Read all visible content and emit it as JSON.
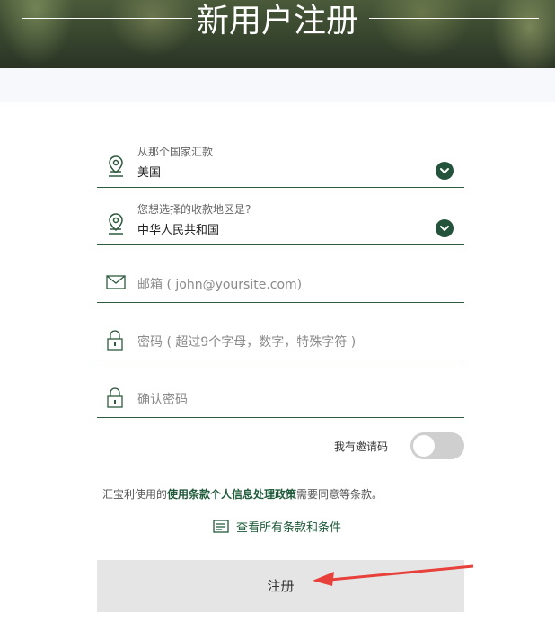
{
  "header": {
    "title": "新用户注册"
  },
  "form": {
    "remit_country": {
      "label": "从那个国家汇款",
      "value": "美国"
    },
    "receive_region": {
      "label": "您想选择的收款地区是?",
      "value": "中华人民共和国"
    },
    "email": {
      "placeholder": "邮箱 ( john@yoursite.com)"
    },
    "password": {
      "placeholder": "密码 ( 超过9个字母，数字，特殊字符 )"
    },
    "confirm_password": {
      "placeholder": "确认密码"
    },
    "invite_toggle": {
      "label": "我有邀请码",
      "on": false
    }
  },
  "terms": {
    "prefix": "汇宝利使用的",
    "link1": "使用条款",
    "link2": "个人信息处理政策",
    "suffix": "需要同意等条款。"
  },
  "view_all": {
    "label": "查看所有条款和条件"
  },
  "submit": {
    "label": "注册"
  },
  "colors": {
    "accent": "#23533b",
    "button_bg": "#e5e5e5",
    "arrow": "#e8403a"
  },
  "icons": [
    "location-pin-icon",
    "chevron-down-icon",
    "mail-icon",
    "lock-icon",
    "document-icon",
    "red-arrow-annotation"
  ]
}
